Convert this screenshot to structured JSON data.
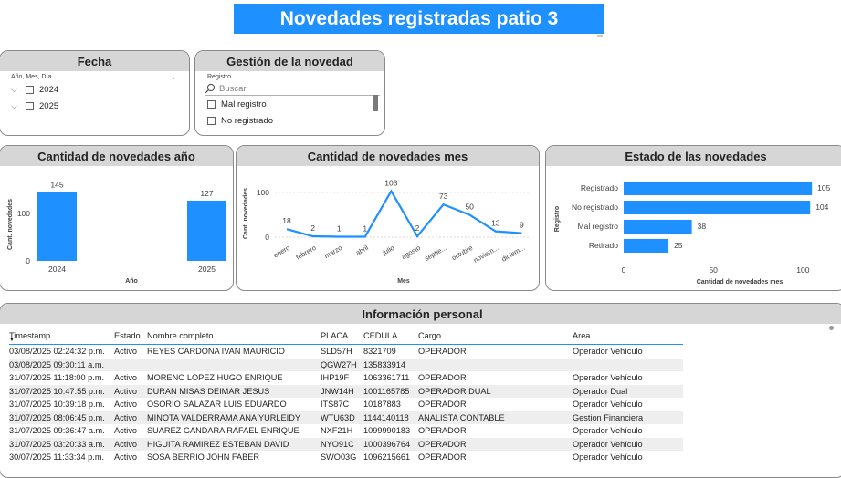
{
  "title": "Novedades registradas patio 3",
  "fecha": {
    "title": "Fecha",
    "hierarchy_label": "Año, Mes, Día",
    "items": [
      "2024",
      "2025"
    ]
  },
  "gestion": {
    "title": "Gestión de la novedad",
    "field_label": "Registro",
    "search_placeholder": "Buscar",
    "items": [
      "Mal registro",
      "No registrado"
    ]
  },
  "chart_year": {
    "title": "Cantidad de novedades año",
    "chart_data": {
      "type": "bar",
      "categories": [
        "2024",
        "2025"
      ],
      "values": [
        145,
        127
      ],
      "xlabel": "Año",
      "ylabel": "Cant. novedades",
      "ylim": [
        0,
        150
      ],
      "yticks": [
        "0",
        "100"
      ],
      "color": "#1e90ff"
    }
  },
  "chart_month": {
    "title": "Cantidad de novedades mes",
    "chart_data": {
      "type": "line",
      "categories": [
        "enero",
        "febrero",
        "marzo",
        "abril",
        "julio",
        "agosto",
        "septie...",
        "octubre",
        "noviem...",
        "diciem..."
      ],
      "values": [
        18,
        2,
        1,
        1,
        103,
        2,
        73,
        50,
        13,
        9
      ],
      "xlabel": "Mes",
      "ylabel": "Cant. novedades",
      "ylim": [
        0,
        110
      ],
      "yticks": [
        "0",
        "100"
      ],
      "color": "#1e90ff"
    }
  },
  "chart_estado": {
    "title": "Estado de las novedades",
    "chart_data": {
      "type": "bar",
      "orientation": "horizontal",
      "categories": [
        "Registrado",
        "No registrado",
        "Mal registro",
        "Retirado"
      ],
      "values": [
        105,
        104,
        38,
        25
      ],
      "xlabel": "Cantidad de novedades mes",
      "ylabel": "Registro",
      "xlim": [
        0,
        110
      ],
      "xticks": [
        "0",
        "50",
        "100"
      ],
      "color": "#1e90ff"
    }
  },
  "table": {
    "title": "Información personal",
    "headers": [
      "Timestamp",
      "Estado",
      "Nombre completo",
      "PLACA",
      "CEDULA",
      "Cargo",
      "Area"
    ],
    "rows": [
      [
        "03/08/2025 02:24:32 p.m.",
        "Activo",
        "REYES CARDONA IVAN MAURICIO",
        "SLD57H",
        "8321709",
        "OPERADOR",
        "Operador Vehículo"
      ],
      [
        "03/08/2025 09:30:11 a.m.",
        "",
        "",
        "QGW27H",
        "135833914",
        "",
        ""
      ],
      [
        "31/07/2025 11:18:00 p.m.",
        "Activo",
        "MORENO LOPEZ HUGO ENRIQUE",
        "IHP19F",
        "1063361711",
        "OPERADOR",
        "Operador Vehículo"
      ],
      [
        "31/07/2025 10:47:55 p.m.",
        "Activo",
        "DURAN MISAS DEIMAR JESUS",
        "JNW14H",
        "1001165785",
        "OPERADOR DUAL",
        "Operador Dual"
      ],
      [
        "31/07/2025 10:39:18 p.m.",
        "Activo",
        "OSORIO SALAZAR LUIS EDUARDO",
        "ITS87C",
        "10187883",
        "OPERADOR",
        "Operador Vehículo"
      ],
      [
        "31/07/2025 08:06:45 p.m.",
        "Activo",
        "MINOTA VALDERRAMA ANA YURLEIDY",
        "WTU63D",
        "1144140118",
        "ANALISTA CONTABLE",
        "Gestion Financiera"
      ],
      [
        "31/07/2025 09:36:47 a.m.",
        "Activo",
        "SUAREZ GANDARA RAFAEL ENRIQUE",
        "NXF21H",
        "1099990183",
        "OPERADOR",
        "Operador Vehículo"
      ],
      [
        "31/07/2025 03:20:33 a.m.",
        "Activo",
        "HIGUITA RAMIREZ ESTEBAN DAVID",
        "NYO91C",
        "1000396764",
        "OPERADOR",
        "Operador Vehículo"
      ],
      [
        "30/07/2025 11:33:34 p.m.",
        "Activo",
        "SOSA BERRIO JOHN FABER",
        "SWO03G",
        "1096215661",
        "OPERADOR",
        "Operador Vehículo"
      ]
    ]
  }
}
